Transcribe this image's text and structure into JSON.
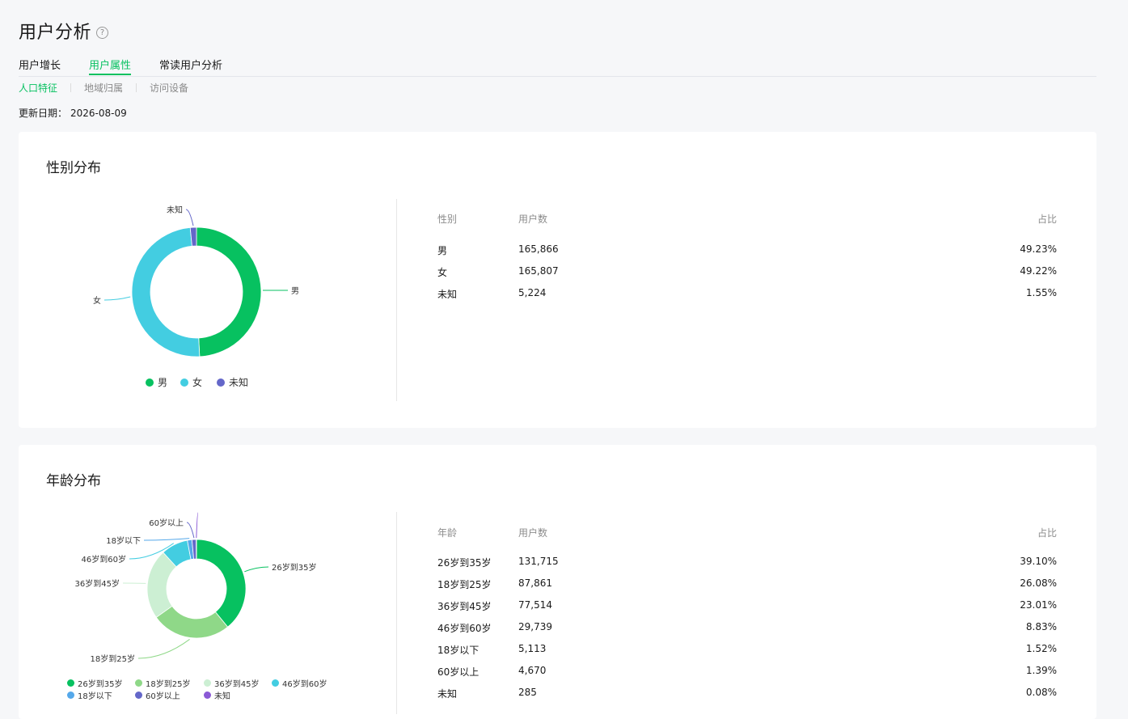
{
  "page": {
    "title": "用户分析",
    "help_icon": "?"
  },
  "tabs": [
    {
      "label": "用户增长",
      "active": false
    },
    {
      "label": "用户属性",
      "active": true
    },
    {
      "label": "常读用户分析",
      "active": false
    }
  ],
  "sub_tabs": [
    {
      "label": "人口特征",
      "active": true
    },
    {
      "label": "地域归属",
      "active": false
    },
    {
      "label": "访问设备",
      "active": false
    }
  ],
  "update": {
    "label": "更新日期：",
    "date": "2026-08-09"
  },
  "gender": {
    "title": "性别分布",
    "table_headers": [
      "性别",
      "用户数",
      "占比"
    ],
    "rows": [
      {
        "name": "男",
        "count": "165,866",
        "pct": "49.23%"
      },
      {
        "name": "女",
        "count": "165,807",
        "pct": "49.22%"
      },
      {
        "name": "未知",
        "count": "5,224",
        "pct": "1.55%"
      }
    ]
  },
  "age": {
    "title": "年龄分布",
    "table_headers": [
      "年龄",
      "用户数",
      "占比"
    ],
    "rows": [
      {
        "name": "26岁到35岁",
        "count": "131,715",
        "pct": "39.10%"
      },
      {
        "name": "18岁到25岁",
        "count": "87,861",
        "pct": "26.08%"
      },
      {
        "name": "36岁到45岁",
        "count": "77,514",
        "pct": "23.01%"
      },
      {
        "name": "46岁到60岁",
        "count": "29,739",
        "pct": "8.83%"
      },
      {
        "name": "18岁以下",
        "count": "5,113",
        "pct": "1.52%"
      },
      {
        "name": "60岁以上",
        "count": "4,670",
        "pct": "1.39%"
      },
      {
        "name": "未知",
        "count": "285",
        "pct": "0.08%"
      }
    ]
  },
  "chart_data": [
    {
      "type": "pie",
      "categories": [
        "男",
        "女",
        "未知"
      ],
      "values": [
        165866,
        165807,
        5224
      ],
      "colors": [
        "#07c160",
        "#43cde1",
        "#6467c9"
      ],
      "legend": "bottom"
    },
    {
      "type": "pie",
      "categories": [
        "26岁到35岁",
        "18岁到25岁",
        "36岁到45岁",
        "46岁到60岁",
        "18岁以下",
        "60岁以上",
        "未知"
      ],
      "values": [
        131715,
        87861,
        77514,
        29739,
        5113,
        4670,
        285
      ],
      "colors": [
        "#07c160",
        "#8fd888",
        "#ccefd3",
        "#43cde1",
        "#55a8ea",
        "#6467c9",
        "#8b5ad6"
      ],
      "legend": "bottom"
    }
  ]
}
